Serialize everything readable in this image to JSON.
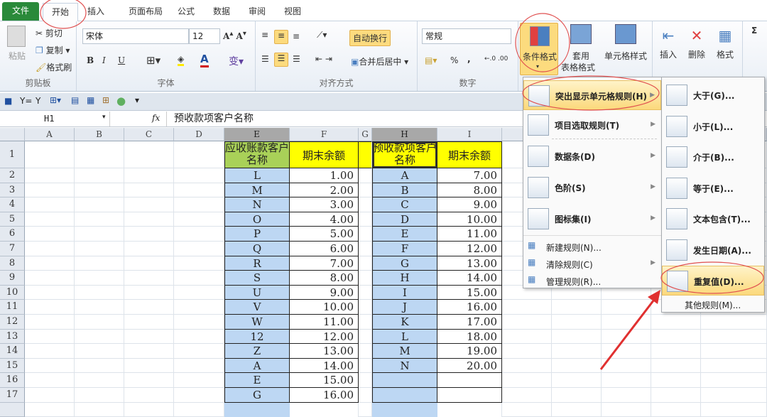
{
  "tabs": [
    "文件",
    "开始",
    "插入",
    "页面布局",
    "公式",
    "数据",
    "审阅",
    "视图"
  ],
  "ribbon": {
    "clipboard": {
      "paste": "粘贴",
      "cut": "剪切",
      "copy": "复制",
      "format_painter": "格式刷",
      "label": "剪贴板"
    },
    "font": {
      "name": "宋体",
      "size": "12",
      "bold": "B",
      "italic": "I",
      "underline": "U",
      "label": "字体"
    },
    "alignment": {
      "wrap": "自动换行",
      "merge": "合并后居中",
      "label": "对齐方式"
    },
    "number": {
      "format": "常规",
      "percent": "%",
      "comma": ",",
      "label": "数字"
    },
    "styles": {
      "conditional": "条件格式",
      "table_format_1": "套用",
      "table_format_2": "表格格式",
      "cell_styles": "单元格样式"
    },
    "cells": {
      "insert": "插入",
      "delete": "删除",
      "format": "格式"
    },
    "editing": {
      "sum": "Σ"
    }
  },
  "formula_bar": {
    "name_box": "H1",
    "fx": "fx",
    "value": "预收款项客户名称"
  },
  "columns": [
    "A",
    "B",
    "C",
    "D",
    "E",
    "F",
    "G",
    "H",
    "I"
  ],
  "rows": [
    "1",
    "2",
    "3",
    "4",
    "5",
    "6",
    "7",
    "8",
    "9",
    "10",
    "11",
    "12",
    "13",
    "14",
    "15",
    "16",
    "17"
  ],
  "table1": {
    "header_name": "应收账款客户名称",
    "header_amount": "期末余额",
    "names": [
      "L",
      "M",
      "N",
      "O",
      "P",
      "Q",
      "R",
      "S",
      "U",
      "V",
      "W",
      "12",
      "Z",
      "A",
      "E",
      "G"
    ],
    "amounts": [
      "1.00",
      "2.00",
      "3.00",
      "4.00",
      "5.00",
      "6.00",
      "7.00",
      "8.00",
      "9.00",
      "10.00",
      "11.00",
      "12.00",
      "13.00",
      "14.00",
      "15.00",
      "16.00"
    ]
  },
  "table2": {
    "header_name": "预收款项客户名称",
    "header_amount": "期末余额",
    "names": [
      "A",
      "B",
      "C",
      "D",
      "E",
      "F",
      "G",
      "H",
      "I",
      "J",
      "K",
      "L",
      "M",
      "N",
      "",
      ""
    ],
    "amounts": [
      "7.00",
      "8.00",
      "9.00",
      "10.00",
      "11.00",
      "12.00",
      "13.00",
      "14.00",
      "15.00",
      "16.00",
      "17.00",
      "18.00",
      "19.00",
      "20.00",
      "",
      ""
    ]
  },
  "menu": {
    "items": [
      {
        "label": "突出显示单元格规则(H)",
        "arrow": true
      },
      {
        "label": "项目选取规则(T)",
        "arrow": true
      },
      {
        "label": "数据条(D)",
        "arrow": true
      },
      {
        "label": "色阶(S)",
        "arrow": true
      },
      {
        "label": "图标集(I)",
        "arrow": true
      }
    ],
    "small_items": [
      {
        "label": "新建规则(N)..."
      },
      {
        "label": "清除规则(C)",
        "arrow": true
      },
      {
        "label": "管理规则(R)..."
      }
    ]
  },
  "submenu": {
    "items": [
      {
        "label": "大于(G)..."
      },
      {
        "label": "小于(L)..."
      },
      {
        "label": "介于(B)..."
      },
      {
        "label": "等于(E)..."
      },
      {
        "label": "文本包含(T)..."
      },
      {
        "label": "发生日期(A)..."
      },
      {
        "label": "重复值(D)..."
      }
    ],
    "more": "其他规则(M)..."
  },
  "colors": {
    "header_green": "#a9d158",
    "header_yellow": "#ffff00",
    "name_blue": "#bdd7f3",
    "annotation_red": "#e04040"
  }
}
